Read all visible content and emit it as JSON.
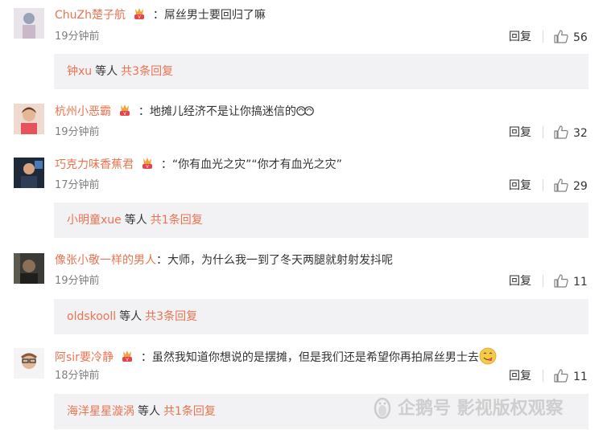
{
  "comments": [
    {
      "user": "ChuZh楚子航",
      "colon": "：",
      "text": "屌丝男士要回归了嘛",
      "time": "19分钟前",
      "reply_label": "回复",
      "likes": "56",
      "sub": {
        "user": "钟xu",
        "mid": "等人",
        "total": "共3条回复"
      }
    },
    {
      "user": "杭州小恶霸",
      "colon": "：",
      "text": "地摊儿经济不是让你搞迷信的",
      "time": "19分钟前",
      "reply_label": "回复",
      "likes": "32"
    },
    {
      "user": "巧克力味香蕉君",
      "colon": "：",
      "text": "“你有血光之灾”“你才有血光之灾”",
      "time": "17分钟前",
      "reply_label": "回复",
      "likes": "29",
      "sub": {
        "user": "小明童xue",
        "mid": "等人",
        "total": "共1条回复"
      }
    },
    {
      "user": "像张小敬一样的男人",
      "colon": "：",
      "text": "大师，为什么我一到了冬天两腿就射射发抖呢",
      "time": "19分钟前",
      "reply_label": "回复",
      "likes": "11",
      "sub": {
        "user": "oldskooll",
        "mid": "等人",
        "total": "共3条回复"
      }
    },
    {
      "user": "阿sir要冷静",
      "colon": "：",
      "text": "虽然我知道你想说的是摆摊，但是我们还是希望你再拍屌丝男士去",
      "time": "18分钟前",
      "reply_label": "回复",
      "likes": "11",
      "sub": {
        "user": "海洋星星漩涡",
        "mid": "等人",
        "total": "共1条回复"
      }
    }
  ],
  "watermark": "企鹅号 影视版权观察",
  "colors": {
    "username": "#eb7350",
    "time": "#808080",
    "subbox_bg": "#f2f2f5"
  }
}
